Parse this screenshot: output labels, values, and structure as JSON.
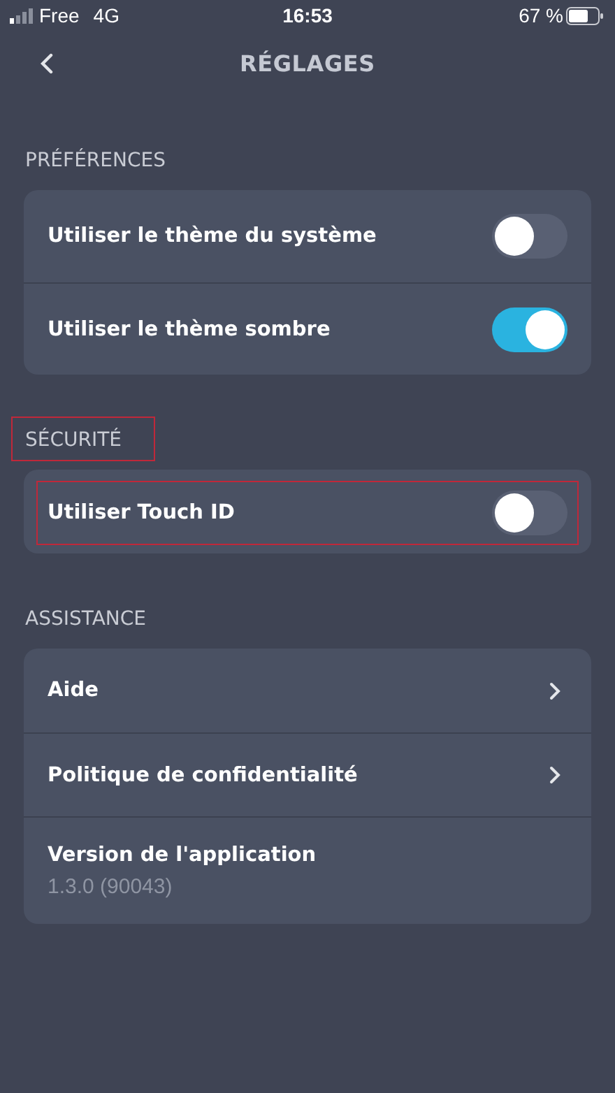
{
  "status_bar": {
    "carrier": "Free",
    "network": "4G",
    "time": "16:53",
    "battery": "67 %"
  },
  "nav": {
    "title": "RÉGLAGES"
  },
  "sections": [
    {
      "title": "PRÉFÉRENCES",
      "highlighted": false,
      "rows": [
        {
          "kind": "toggle",
          "label": "Utiliser le thème du système",
          "on": false,
          "highlighted": false
        },
        {
          "kind": "toggle",
          "label": "Utiliser le thème sombre",
          "on": true,
          "highlighted": false
        }
      ]
    },
    {
      "title": "SÉCURITÉ",
      "highlighted": true,
      "rows": [
        {
          "kind": "toggle",
          "label": "Utiliser Touch ID",
          "on": false,
          "highlighted": true
        }
      ]
    },
    {
      "title": "ASSISTANCE",
      "highlighted": false,
      "rows": [
        {
          "kind": "link",
          "label": "Aide",
          "highlighted": false
        },
        {
          "kind": "link",
          "label": "Politique de confidentialité",
          "highlighted": false
        },
        {
          "kind": "info",
          "label": "Version de l'application",
          "value": "1.3.0 (90043)",
          "highlighted": false
        }
      ]
    }
  ]
}
